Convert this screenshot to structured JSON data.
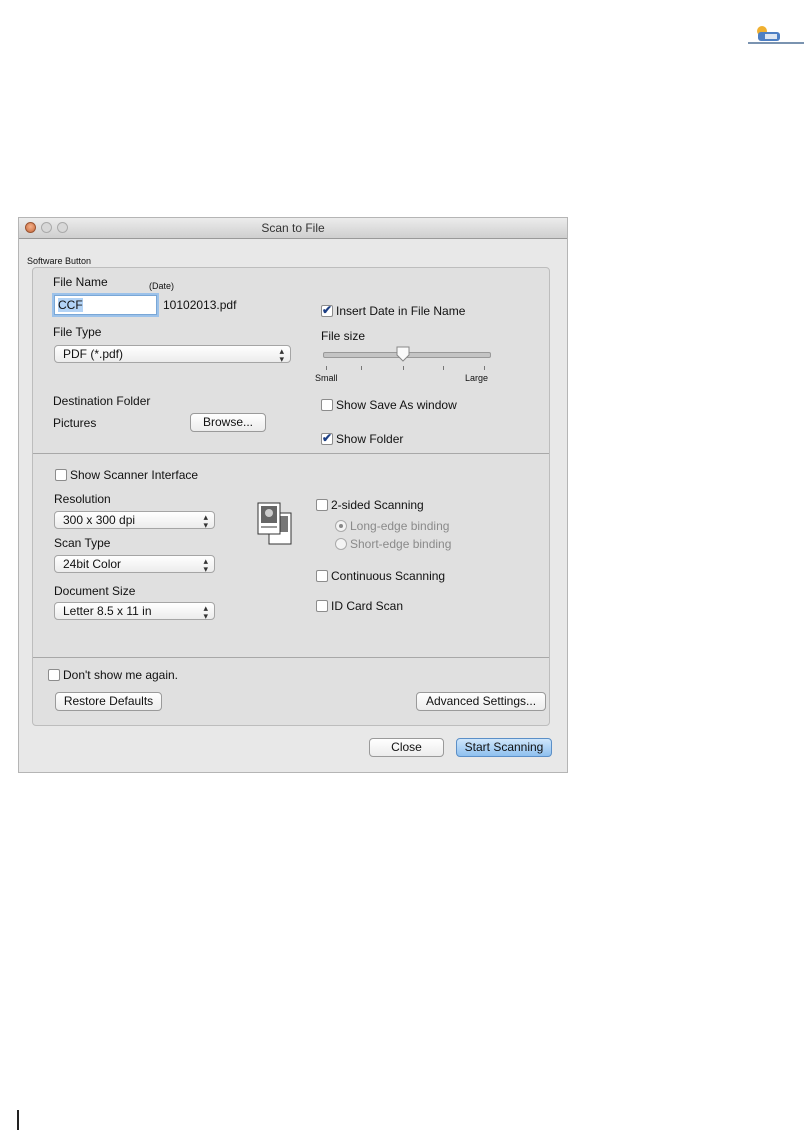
{
  "window": {
    "title": "Scan to File"
  },
  "group_label": "Software Button",
  "file_name": {
    "label": "File Name",
    "date_label": "(Date)",
    "value": "CCF",
    "date_suffix": "10102013.pdf"
  },
  "insert_date": {
    "label": "Insert Date in File Name",
    "checked": true
  },
  "file_type": {
    "label": "File Type",
    "value": "PDF (*.pdf)"
  },
  "file_size": {
    "label": "File size",
    "min_label": "Small",
    "max_label": "Large",
    "level": 0.5
  },
  "destination": {
    "label": "Destination Folder",
    "folder": "Pictures",
    "browse": "Browse..."
  },
  "show_save_as": {
    "label": "Show Save As window",
    "checked": false
  },
  "show_folder": {
    "label": "Show Folder",
    "checked": true
  },
  "show_scanner_interface": {
    "label": "Show Scanner Interface",
    "checked": false
  },
  "resolution": {
    "label": "Resolution",
    "value": "300 x 300 dpi"
  },
  "scan_type": {
    "label": "Scan Type",
    "value": "24bit Color"
  },
  "document_size": {
    "label": "Document Size",
    "value": "Letter 8.5 x 11 in"
  },
  "two_sided": {
    "label": "2-sided Scanning",
    "checked": false,
    "long_edge": "Long-edge binding",
    "short_edge": "Short-edge binding"
  },
  "continuous": {
    "label": "Continuous Scanning",
    "checked": false
  },
  "id_card": {
    "label": "ID Card Scan",
    "checked": false
  },
  "dont_show": {
    "label": "Don't show me again.",
    "checked": false
  },
  "buttons": {
    "restore": "Restore Defaults",
    "advanced": "Advanced Settings...",
    "close": "Close",
    "start": "Start Scanning"
  },
  "check_glyph": "✔"
}
